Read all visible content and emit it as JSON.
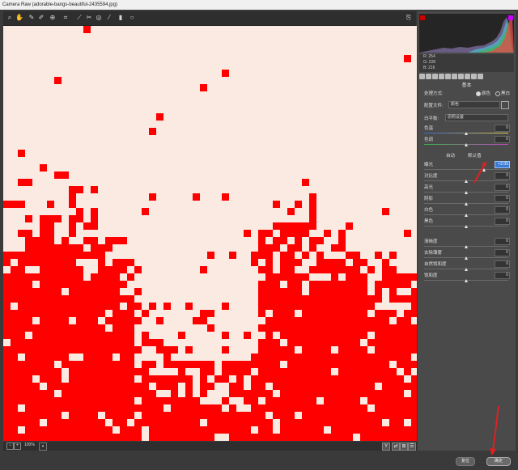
{
  "window": {
    "title": "Camera Raw (adorable-bangs-beautiful-2435594.jpg)"
  },
  "toolbar": {
    "tools": [
      "zoom-icon",
      "hand-icon",
      "eyedropper-icon",
      "color-sampler-icon",
      "target-icon",
      "crop-icon",
      "straighten-icon",
      "spot-removal-icon",
      "red-eye-icon",
      "adjustment-brush-icon",
      "graduated-filter-icon",
      "radial-filter-icon"
    ],
    "right_tool": "open-preferences-icon"
  },
  "image_view": {
    "zoom_label": "100%",
    "clip_color": "#ff0000",
    "skin_color": "#f8e6dc"
  },
  "histogram": {
    "readout": [
      {
        "label": "R:",
        "value": "254"
      },
      {
        "label": "G:",
        "value": "228"
      },
      {
        "label": "B:",
        "value": "216"
      }
    ]
  },
  "panel": {
    "section_title": "基本",
    "treatment": {
      "label": "处理方式:",
      "options": [
        "颜色",
        "黑白"
      ],
      "selected": "颜色"
    },
    "profile": {
      "label": "配置文件:",
      "value": "颜色"
    },
    "white_balance": {
      "label": "白平衡:",
      "value": "原照设置"
    },
    "temperature": {
      "label": "色温",
      "value": "0"
    },
    "tint": {
      "label": "色调",
      "value": "0"
    },
    "auto_label": "自动",
    "default_label": "默认值",
    "sliders": [
      {
        "label": "曝光",
        "value": "+2.05",
        "level": 0.71,
        "highlight": true
      },
      {
        "label": "对比度",
        "value": "0",
        "level": 0.5
      },
      {
        "label": "高光",
        "value": "0",
        "level": 0.5
      },
      {
        "label": "阴影",
        "value": "0",
        "level": 0.5
      },
      {
        "label": "白色",
        "value": "0",
        "level": 0.5
      },
      {
        "label": "黑色",
        "value": "0",
        "level": 0.5
      },
      {
        "label": "清晰度",
        "value": "0",
        "level": 0.5
      },
      {
        "label": "去除薄雾",
        "value": "0",
        "level": 0.5
      },
      {
        "label": "自然饱和度",
        "value": "0",
        "level": 0.5
      },
      {
        "label": "饱和度",
        "value": "0",
        "level": 0.5
      }
    ]
  },
  "footer": {
    "reset_label": "复位",
    "ok_label": "确定"
  }
}
